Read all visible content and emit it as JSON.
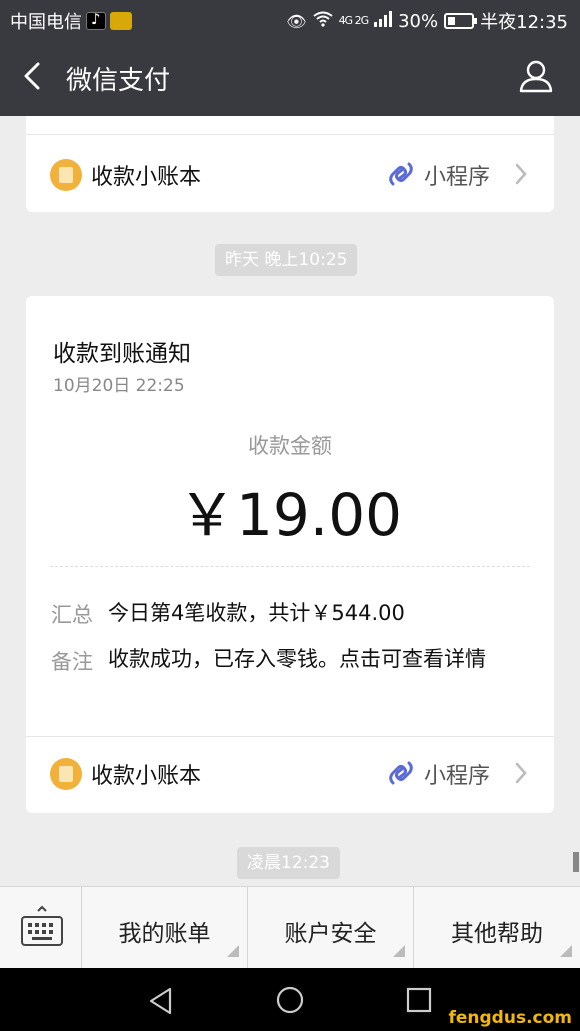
{
  "status_bar": {
    "carrier": "中国电信",
    "battery": "30%",
    "time": "半夜12:35",
    "network": "4G 2G"
  },
  "header": {
    "title": "微信支付"
  },
  "top_card": {
    "footer_name": "收款小账本",
    "mini_program_label": "小程序"
  },
  "timestamps": {
    "yesterday": "昨天 晚上10:25",
    "early": "凌晨12:23"
  },
  "notice": {
    "title": "收款到账通知",
    "date": "10月20日  22:25",
    "amount_label": "收款金额",
    "amount": "￥19.00",
    "summary_label": "汇总",
    "summary_value": "今日第4笔收款，共计￥544.00",
    "remark_label": "备注",
    "remark_value": "收款成功，已存入零钱。点击可查看详情",
    "footer_name": "收款小账本",
    "mini_program_label": "小程序"
  },
  "menu": {
    "items": [
      "我的账单",
      "账户安全",
      "其他帮助"
    ]
  },
  "watermark": "fengdus.com",
  "colors": {
    "bar": "#393a3f",
    "coin": "#f1b13a",
    "mini_program": "#5b6bd5"
  }
}
